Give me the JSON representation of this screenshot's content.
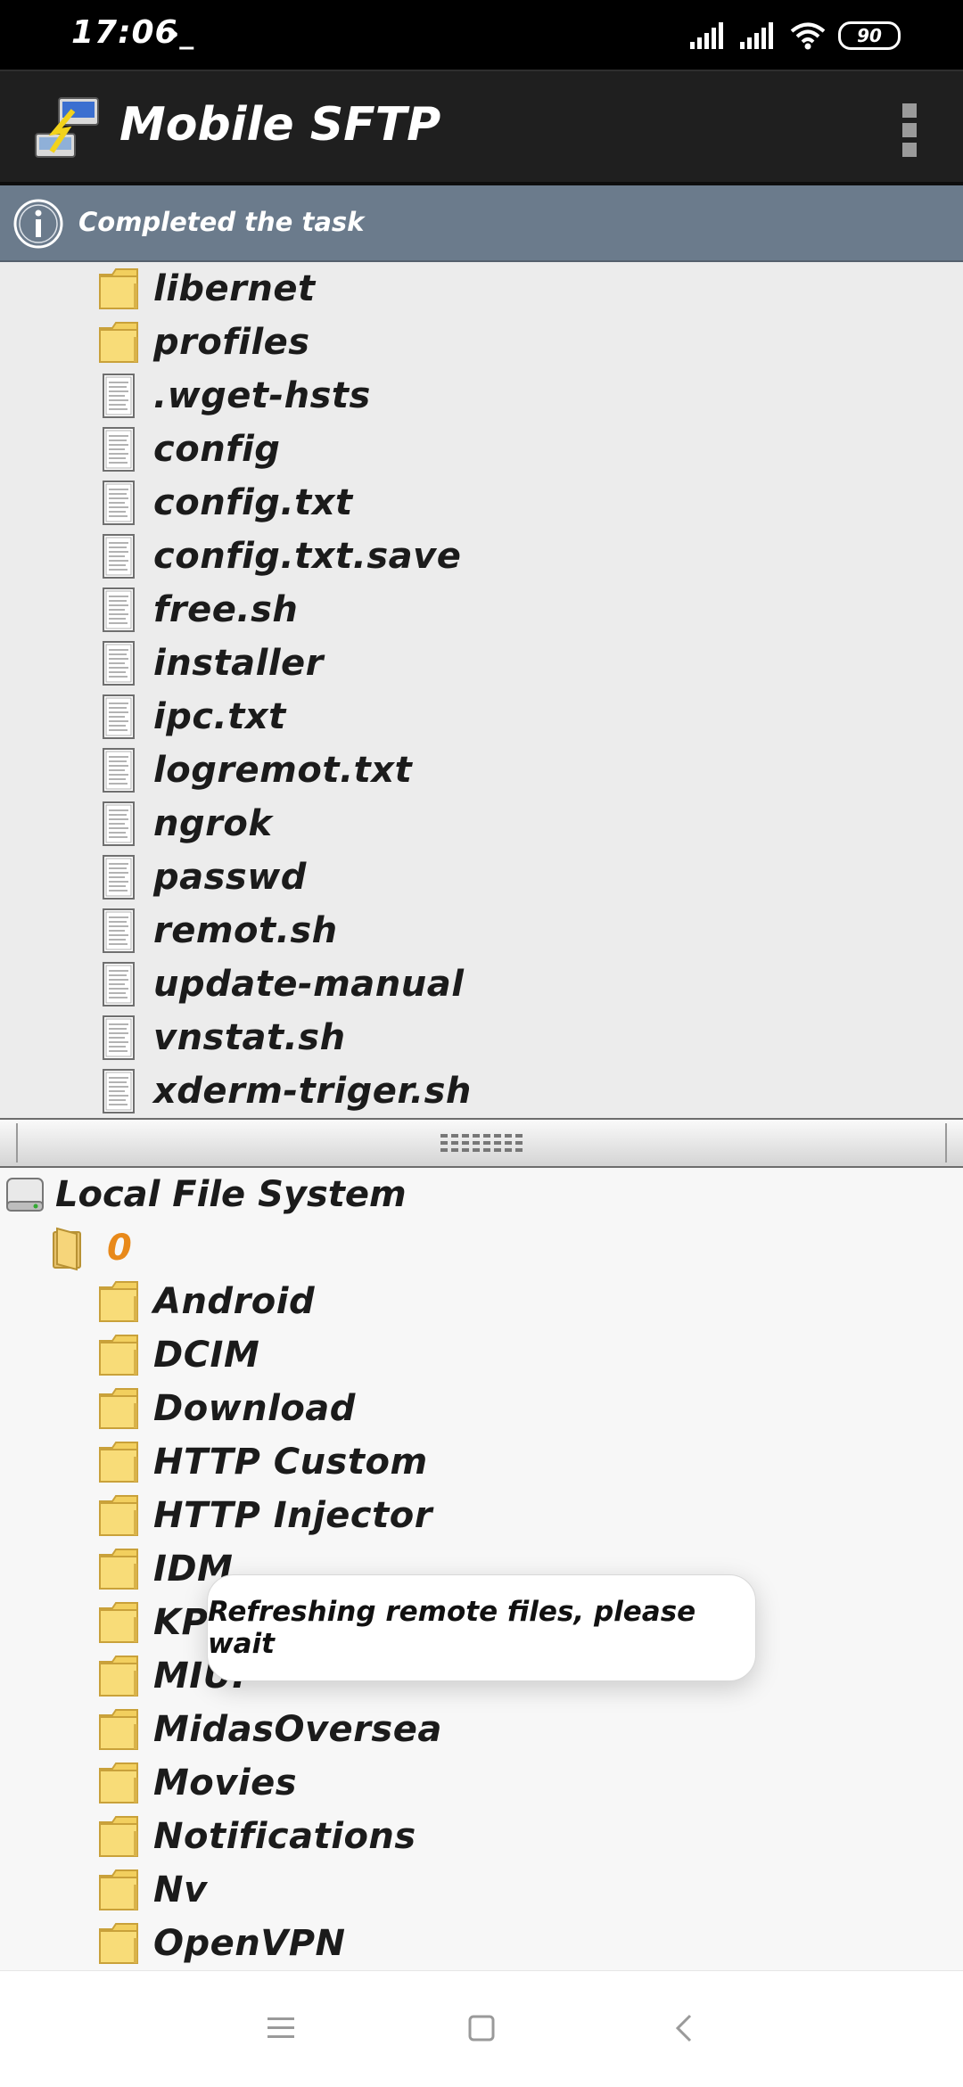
{
  "status_bar": {
    "time": "17:06",
    "terminal_glyph": "›_",
    "battery": "90"
  },
  "app": {
    "title": "Mobile SFTP"
  },
  "notice": {
    "text": "Completed the task"
  },
  "remote_items": [
    {
      "name": "libernet",
      "type": "folder"
    },
    {
      "name": "profiles",
      "type": "folder"
    },
    {
      "name": ".wget-hsts",
      "type": "file"
    },
    {
      "name": "config",
      "type": "file"
    },
    {
      "name": "config.txt",
      "type": "file"
    },
    {
      "name": "config.txt.save",
      "type": "file"
    },
    {
      "name": "free.sh",
      "type": "file"
    },
    {
      "name": "installer",
      "type": "file"
    },
    {
      "name": "ipc.txt",
      "type": "file"
    },
    {
      "name": "logremot.txt",
      "type": "file"
    },
    {
      "name": "ngrok",
      "type": "file"
    },
    {
      "name": "passwd",
      "type": "file"
    },
    {
      "name": "remot.sh",
      "type": "file"
    },
    {
      "name": "update-manual",
      "type": "file"
    },
    {
      "name": "vnstat.sh",
      "type": "file"
    },
    {
      "name": "xderm-triger.sh",
      "type": "file"
    }
  ],
  "local": {
    "root_label": "Local File System",
    "folder_0": "0",
    "items": [
      {
        "name": "Android"
      },
      {
        "name": "DCIM"
      },
      {
        "name": "Download"
      },
      {
        "name": "HTTP Custom"
      },
      {
        "name": "HTTP Injector"
      },
      {
        "name": "IDM"
      },
      {
        "name": "KPN Tunnel Rev"
      },
      {
        "name": "MIUI"
      },
      {
        "name": "MidasOversea"
      },
      {
        "name": "Movies"
      },
      {
        "name": "Notifications"
      },
      {
        "name": "Nv"
      },
      {
        "name": "OpenVPN"
      }
    ]
  },
  "toast": {
    "text": "Refreshing remote files, please wait"
  },
  "colors": {
    "app_bar": "#1f1f1f",
    "notice_strip": "#6b7b8c",
    "folder_zero": "#e8891a"
  },
  "icons": {
    "app": "sftp-plug-icon",
    "notice": "info-icon",
    "folder": "folder-icon",
    "file": "text-file-icon",
    "drive": "drive-icon"
  }
}
